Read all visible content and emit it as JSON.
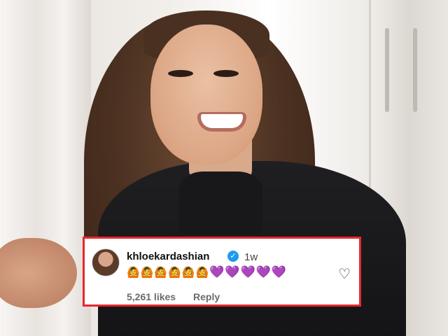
{
  "comment": {
    "username": "khloekardashian",
    "verified_glyph": "✓",
    "time_ago": "1w",
    "emojis": [
      "🙆",
      "🙆",
      "🙆",
      "🙆",
      "🙆",
      "🙆",
      "💜",
      "💜",
      "💜",
      "💜",
      "💜"
    ],
    "likes": "5,261 likes",
    "reply_label": "Reply",
    "like_icon": "♡",
    "border_color": "#e8272f",
    "verified_color": "#1d9bf0"
  }
}
